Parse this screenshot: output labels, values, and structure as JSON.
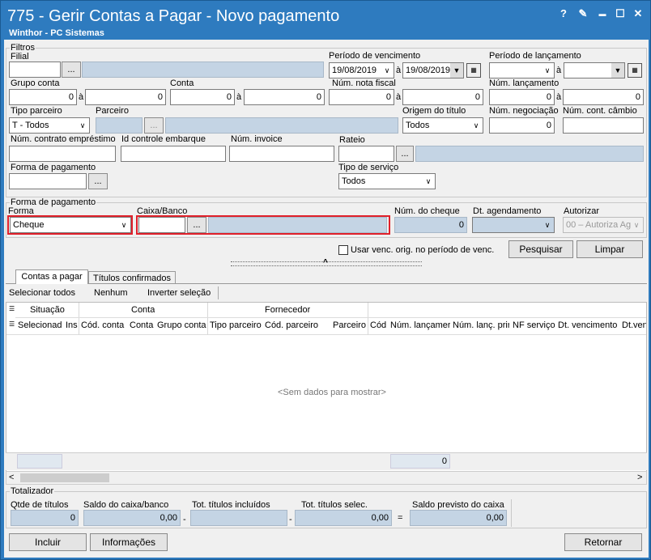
{
  "window": {
    "title": "775 - Gerir Contas a Pagar - Novo pagamento",
    "subtitle": "Winthor - PC Sistemas",
    "btn_help": "?",
    "btn_edit": "✎",
    "btn_min": "▬",
    "btn_max": "☐",
    "btn_close": "✕"
  },
  "filtros": {
    "title": "Filtros",
    "filial": "Filial",
    "periodo_venc": "Período  de vencimento",
    "venc_de": "19/08/2019",
    "venc_ate": "19/08/2019",
    "a": "à",
    "periodo_lanc": "Período  de lançamento",
    "grupo_conta": "Grupo conta",
    "grupo_de": "0",
    "grupo_ate": "0",
    "conta": "Conta",
    "conta_de": "0",
    "conta_ate": "0",
    "num_nota": "Núm. nota fiscal",
    "nota_de": "0",
    "nota_ate": "0",
    "num_lanc": "Núm. lançamento",
    "lanc_de": "0",
    "lanc_ate": "0",
    "tipo_parceiro": "Tipo parceiro",
    "tipo_parceiro_val": "T - Todos",
    "parceiro": "Parceiro",
    "origem": "Origem do título",
    "origem_val": "Todos",
    "num_negoc": "Núm. negociação",
    "negoc_val": "0",
    "num_cambio": "Núm. cont. câmbio",
    "num_contrato": "Núm. contrato empréstimo",
    "id_embarque": "Id controle embarque",
    "num_invoice": "Núm. invoice",
    "rateio": "Rateio",
    "forma_pag": "Forma de pagamento",
    "tipo_servico": "Tipo de serviço",
    "tipo_servico_val": "Todos",
    "dots": "..."
  },
  "forma": {
    "title": "Forma de pagamento",
    "forma": "Forma",
    "forma_val": "Cheque",
    "caixa": "Caixa/Banco",
    "num_cheque": "Núm. do cheque",
    "cheque_val": "0",
    "dt_agend": "Dt. agendamento",
    "autorizar": "Autorizar",
    "autorizar_val": "00 – Autoriza Ag"
  },
  "actions": {
    "usar_venc": "Usar venc. orig. no período de venc.",
    "pesquisar": "Pesquisar",
    "limpar": "Limpar"
  },
  "tabs": [
    "Contas a pagar",
    "Títulos confirmados"
  ],
  "grid_toolbar": [
    "Selecionar todos",
    "Nenhum",
    "Inverter seleção"
  ],
  "grid": {
    "band_situacao": "Situação",
    "band_conta": "Conta",
    "band_fornecedor": "Fornecedor",
    "cols": [
      "Selecionad",
      "Ins",
      "Cód. conta",
      "Conta",
      "Grupo conta",
      "Tipo parceiro",
      "Cód. parceiro",
      "Parceiro",
      "Cód",
      "Núm. lançamer",
      "Núm. lanç. prir",
      "NF serviço",
      "Dt. vencimento",
      "Dt.ven"
    ],
    "empty": "<Sem dados para mostrar>",
    "footer_val": "0"
  },
  "totalizador": {
    "title": "Totalizador",
    "qtde": "Qtde de títulos",
    "qtde_val": "0",
    "saldo_caixa": "Saldo do caixa/banco",
    "saldo_caixa_val": "0,00",
    "tot_incl": "Tot. títulos incluídos",
    "tot_sel": "Tot. títulos selec.",
    "tot_sel_val": "0,00",
    "saldo_prev": "Saldo previsto do caixa",
    "saldo_prev_val": "0,00",
    "minus": "-",
    "eq": "="
  },
  "bottom": {
    "incluir": "Incluir",
    "informacoes": "Informações",
    "retornar": "Retornar"
  }
}
